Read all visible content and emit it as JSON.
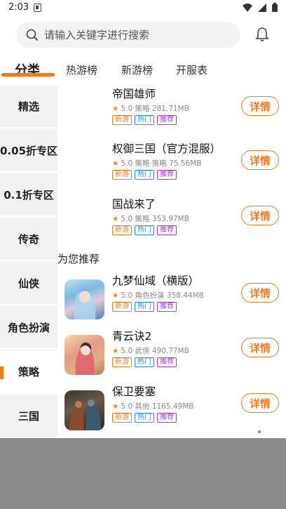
{
  "status": {
    "time": "2:03"
  },
  "search": {
    "placeholder": "请输入关键字进行搜索"
  },
  "tabs": [
    {
      "label": "分类"
    },
    {
      "label": "热游榜"
    },
    {
      "label": "新游榜"
    },
    {
      "label": "开服表"
    }
  ],
  "sidebar": {
    "items": [
      {
        "label": "精选"
      },
      {
        "label": "0.05折专区"
      },
      {
        "label": "0.1折专区"
      },
      {
        "label": "传奇"
      },
      {
        "label": "仙侠"
      },
      {
        "label": "角色扮演"
      },
      {
        "label": "策略"
      },
      {
        "label": "三国"
      }
    ]
  },
  "games": [
    {
      "name": "帝国雄师",
      "rating": "5.0",
      "genre": "策略",
      "size": "281.71MB",
      "tags": [
        "新游",
        "热门",
        "推荐"
      ]
    },
    {
      "name": "权御三国（官方混服）",
      "rating": "5.0",
      "genre": "策略·策略",
      "size": "75.56MB",
      "tags": [
        "新游",
        "热门",
        "推荐"
      ]
    },
    {
      "name": "国战来了",
      "rating": "5.0",
      "genre": "策略",
      "size": "353.97MB",
      "tags": [
        "新游",
        "热门",
        "推荐"
      ]
    }
  ],
  "recommend": {
    "title": "为您推荐",
    "games": [
      {
        "name": "九梦仙域（横版）",
        "rating": "5.0",
        "genre": "角色扮演",
        "size": "358.44MB",
        "tags": [
          "新游",
          "热门",
          "推荐"
        ]
      },
      {
        "name": "青云诀2",
        "rating": "5.0",
        "genre": "武侠",
        "size": "490.77MB",
        "tags": [
          "新游",
          "热门",
          "推荐"
        ]
      },
      {
        "name": "保卫要塞",
        "rating": "5.0",
        "genre": "其他",
        "size": "1165.49MB",
        "tags": [
          "新游",
          "热门",
          "推荐"
        ]
      }
    ]
  },
  "detail_label": "详情",
  "colors": {
    "accent": "#f07a1e",
    "tag_new": "#f07a1e",
    "tag_hot": "#2a86e0",
    "tag_rec": "#9b3fd6"
  }
}
